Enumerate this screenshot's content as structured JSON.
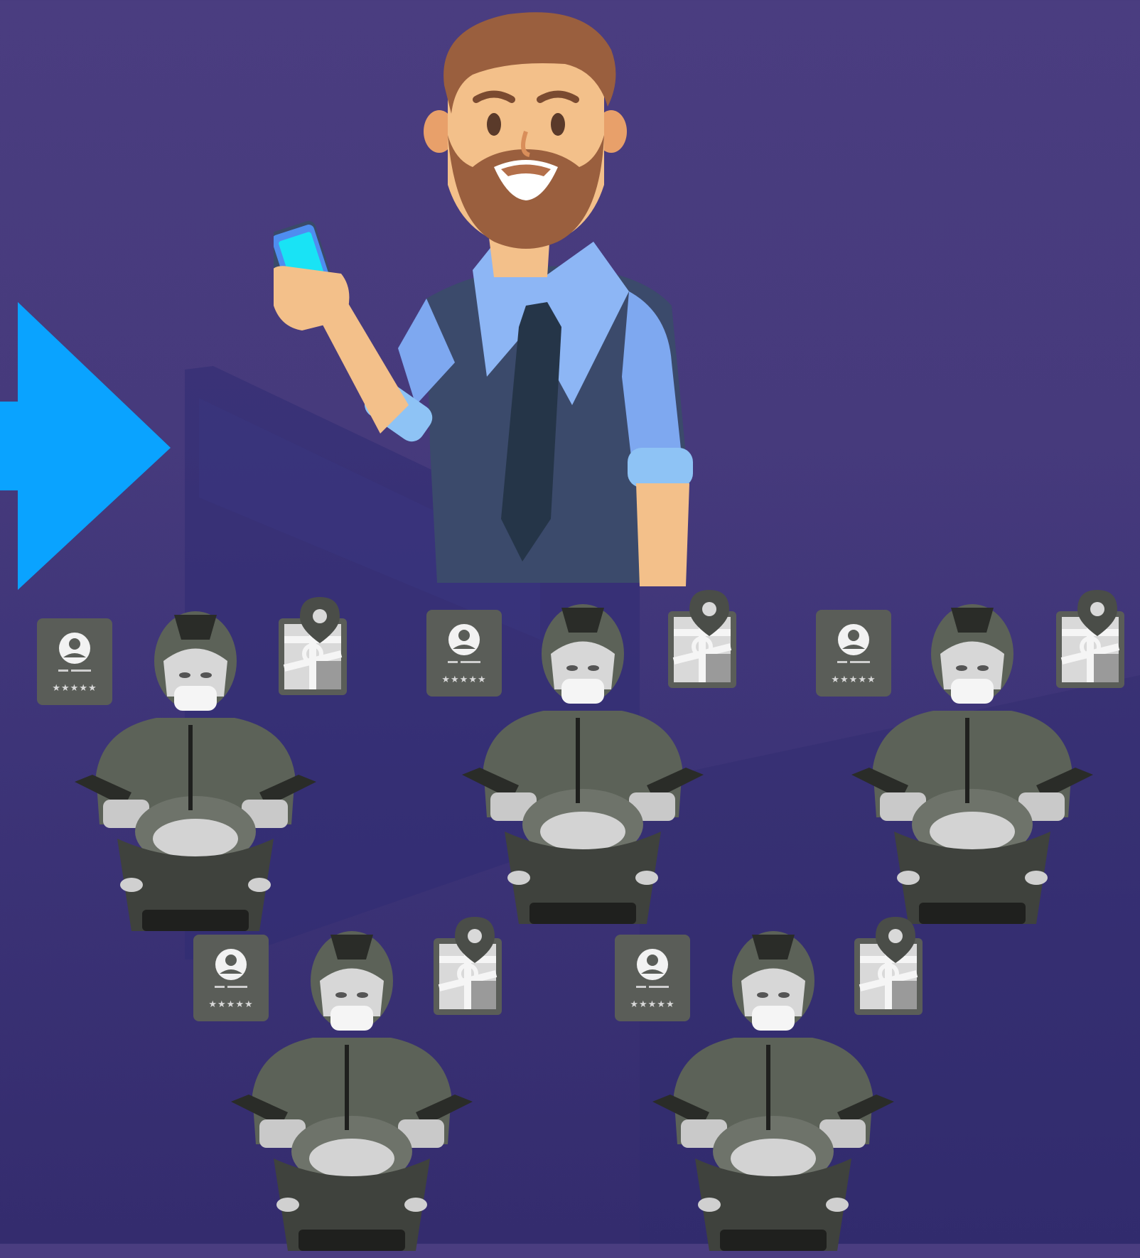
{
  "colors": {
    "background_top": "#4a3d80",
    "background_bottom": "#342c6e",
    "arrow": "#0aa3ff",
    "shirt": "#7ea8f0",
    "vest": "#3b4a6b",
    "tie": "#253548",
    "skin": "#f3c08a",
    "beard": "#9a5f3e",
    "phone_screen": "#19e3f5",
    "rider_suit": "#5c6258",
    "card_bg": "#5a5d58"
  },
  "icons": {
    "arrow": "right-arrow-icon",
    "customer": "man-with-phone-illustration",
    "rider": "scooter-rider-illustration",
    "profile": "driver-profile-card-icon",
    "map": "map-location-pin-icon"
  },
  "riders": [
    {
      "rating_stars": "★★★★★",
      "rating": 5
    },
    {
      "rating_stars": "★★★★★",
      "rating": 5
    },
    {
      "rating_stars": "★★★★★",
      "rating": 5
    },
    {
      "rating_stars": "★★★★★",
      "rating": 5
    },
    {
      "rating_stars": "★★★★★",
      "rating": 5
    }
  ]
}
